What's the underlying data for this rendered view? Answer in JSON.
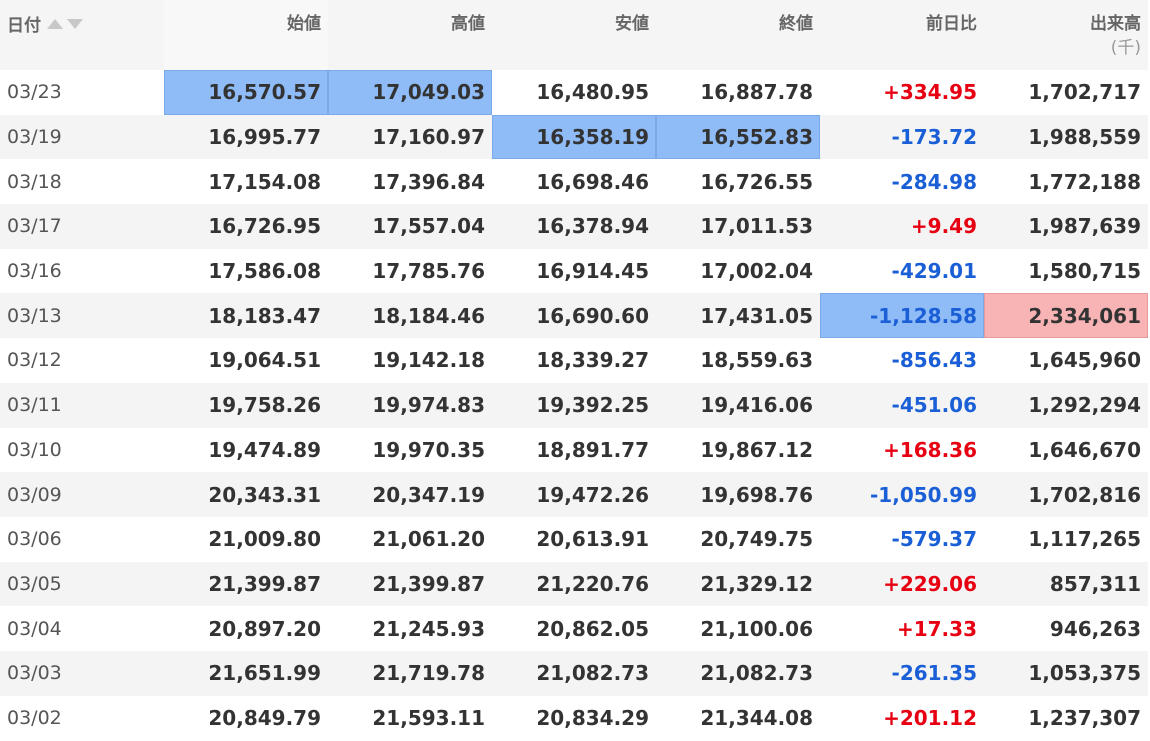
{
  "headers": {
    "date": "日付",
    "open": "始値",
    "high": "高値",
    "low": "安値",
    "close": "終値",
    "change": "前日比",
    "volume": "出来高",
    "volume_unit": "(千)"
  },
  "colors": {
    "positive": "#e60012",
    "negative": "#1a5fd6",
    "highlight_blue": "#8fbcf7",
    "highlight_red": "#f8b4b4"
  },
  "rows": [
    {
      "date": "03/23",
      "open": "16,570.57",
      "high": "17,049.03",
      "low": "16,480.95",
      "close": "16,887.78",
      "change": "+334.95",
      "volume": "1,702,717"
    },
    {
      "date": "03/19",
      "open": "16,995.77",
      "high": "17,160.97",
      "low": "16,358.19",
      "close": "16,552.83",
      "change": "-173.72",
      "volume": "1,988,559"
    },
    {
      "date": "03/18",
      "open": "17,154.08",
      "high": "17,396.84",
      "low": "16,698.46",
      "close": "16,726.55",
      "change": "-284.98",
      "volume": "1,772,188"
    },
    {
      "date": "03/17",
      "open": "16,726.95",
      "high": "17,557.04",
      "low": "16,378.94",
      "close": "17,011.53",
      "change": "+9.49",
      "volume": "1,987,639"
    },
    {
      "date": "03/16",
      "open": "17,586.08",
      "high": "17,785.76",
      "low": "16,914.45",
      "close": "17,002.04",
      "change": "-429.01",
      "volume": "1,580,715"
    },
    {
      "date": "03/13",
      "open": "18,183.47",
      "high": "18,184.46",
      "low": "16,690.60",
      "close": "17,431.05",
      "change": "-1,128.58",
      "volume": "2,334,061"
    },
    {
      "date": "03/12",
      "open": "19,064.51",
      "high": "19,142.18",
      "low": "18,339.27",
      "close": "18,559.63",
      "change": "-856.43",
      "volume": "1,645,960"
    },
    {
      "date": "03/11",
      "open": "19,758.26",
      "high": "19,974.83",
      "low": "19,392.25",
      "close": "19,416.06",
      "change": "-451.06",
      "volume": "1,292,294"
    },
    {
      "date": "03/10",
      "open": "19,474.89",
      "high": "19,970.35",
      "low": "18,891.77",
      "close": "19,867.12",
      "change": "+168.36",
      "volume": "1,646,670"
    },
    {
      "date": "03/09",
      "open": "20,343.31",
      "high": "20,347.19",
      "low": "19,472.26",
      "close": "19,698.76",
      "change": "-1,050.99",
      "volume": "1,702,816"
    },
    {
      "date": "03/06",
      "open": "21,009.80",
      "high": "21,061.20",
      "low": "20,613.91",
      "close": "20,749.75",
      "change": "-579.37",
      "volume": "1,117,265"
    },
    {
      "date": "03/05",
      "open": "21,399.87",
      "high": "21,399.87",
      "low": "21,220.76",
      "close": "21,329.12",
      "change": "+229.06",
      "volume": "857,311"
    },
    {
      "date": "03/04",
      "open": "20,897.20",
      "high": "21,245.93",
      "low": "20,862.05",
      "close": "21,100.06",
      "change": "+17.33",
      "volume": "946,263"
    },
    {
      "date": "03/03",
      "open": "21,651.99",
      "high": "21,719.78",
      "low": "21,082.73",
      "close": "21,082.73",
      "change": "-261.35",
      "volume": "1,053,375"
    },
    {
      "date": "03/02",
      "open": "20,849.79",
      "high": "21,593.11",
      "low": "20,834.29",
      "close": "21,344.08",
      "change": "+201.12",
      "volume": "1,237,307"
    }
  ]
}
